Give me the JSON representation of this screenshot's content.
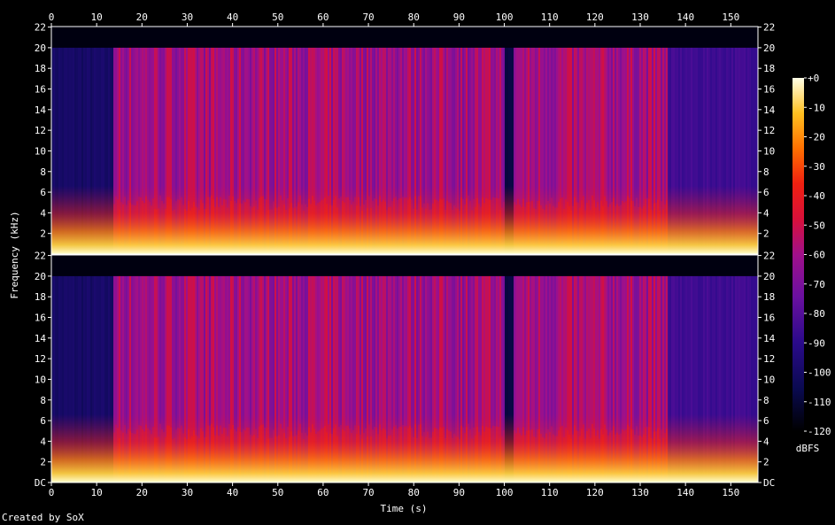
{
  "chart_data": {
    "type": "heatmap",
    "title": "",
    "xlabel": "Time (s)",
    "ylabel": "Frequency (kHz)",
    "x_ticks": [
      0,
      10,
      20,
      30,
      40,
      50,
      60,
      70,
      80,
      90,
      100,
      110,
      120,
      130,
      140,
      150
    ],
    "xlim": [
      0,
      156
    ],
    "ylim_khz": [
      0,
      22.05
    ],
    "y_ticks": [
      {
        "value": 0,
        "label": "DC"
      },
      {
        "value": 2,
        "label": "2"
      },
      {
        "value": 4,
        "label": "4"
      },
      {
        "value": 6,
        "label": "6"
      },
      {
        "value": 8,
        "label": "8"
      },
      {
        "value": 10,
        "label": "10"
      },
      {
        "value": 12,
        "label": "12"
      },
      {
        "value": 14,
        "label": "14"
      },
      {
        "value": 16,
        "label": "16"
      },
      {
        "value": 18,
        "label": "18"
      },
      {
        "value": 20,
        "label": "20"
      },
      {
        "value": 22,
        "label": "22"
      }
    ],
    "channels": 2,
    "colorbar": {
      "label": "dBFS",
      "range": [
        -120,
        0
      ],
      "ticks": [
        {
          "value": 0,
          "label": "+0"
        },
        {
          "value": -10,
          "label": "-10"
        },
        {
          "value": -20,
          "label": "-20"
        },
        {
          "value": -30,
          "label": "-30"
        },
        {
          "value": -40,
          "label": "-40"
        },
        {
          "value": -50,
          "label": "-50"
        },
        {
          "value": -60,
          "label": "-60"
        },
        {
          "value": -70,
          "label": "-70"
        },
        {
          "value": -80,
          "label": "-80"
        },
        {
          "value": -90,
          "label": "-90"
        },
        {
          "value": -100,
          "label": "-100"
        },
        {
          "value": -110,
          "label": "-110"
        },
        {
          "value": -120,
          "label": "-120"
        }
      ]
    },
    "segments_level_dbfs": [
      {
        "start": 0,
        "end": 13.5,
        "level": -100
      },
      {
        "start": 13.5,
        "end": 100,
        "level": -60
      },
      {
        "start": 100,
        "end": 102,
        "level": -110
      },
      {
        "start": 102,
        "end": 136,
        "level": -60
      },
      {
        "start": 136,
        "end": 156,
        "level": -85
      }
    ],
    "cutoff_khz": 20,
    "grid": false,
    "legend": "none"
  },
  "footer": "Created by SoX"
}
